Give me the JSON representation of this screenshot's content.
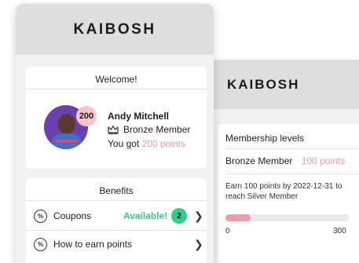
{
  "app": {
    "brand": "KAIBOSH"
  },
  "front": {
    "welcome": {
      "title": "Welcome!",
      "points_badge": "200",
      "user_name": "Andy Mitchell",
      "membership": "Bronze Member",
      "points_prefix": "You got ",
      "points_value": "200 points"
    },
    "benefits": {
      "title": "Benefits",
      "items": [
        {
          "label": "Coupons",
          "status": "Available!",
          "count": "2",
          "icon": "percent-icon"
        },
        {
          "label": "How to earn points",
          "icon": "percent-icon"
        }
      ]
    }
  },
  "back": {
    "levels": {
      "title": "Membership levels",
      "current_level": "Bronze Member",
      "current_points": "100 points",
      "note": "Earn 100 points by 2022-12-31 to reach Silver Member",
      "progress_min": "0",
      "progress_max": "300",
      "progress_fraction": 0.2
    }
  },
  "colors": {
    "accent_pink": "#f29aa8",
    "badge_pink": "#f7c4cd",
    "available_green": "#3cc88f",
    "header_gray": "#dedede"
  }
}
